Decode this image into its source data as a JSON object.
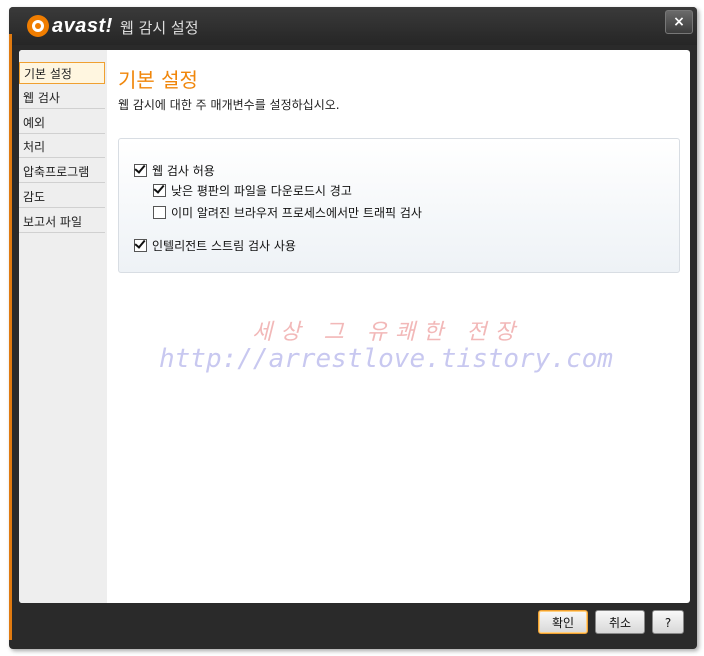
{
  "window": {
    "title": "웹 감시 설정",
    "logo_text": "avast!",
    "close_label": "×"
  },
  "sidebar": {
    "items": [
      {
        "label": "기본 설정",
        "active": true
      },
      {
        "label": "웹 검사",
        "active": false
      },
      {
        "label": "예외",
        "active": false
      },
      {
        "label": "처리",
        "active": false
      },
      {
        "label": "압축프로그램",
        "active": false
      },
      {
        "label": "감도",
        "active": false
      },
      {
        "label": "보고서 파일",
        "active": false
      }
    ]
  },
  "main": {
    "title": "기본 설정",
    "description": "웹 감시에 대한 주 매개변수를 설정하십시오.",
    "options": [
      {
        "label": "웹 검사 허용",
        "checked": true
      },
      {
        "label": "낮은 평판의 파일을 다운로드시 경고",
        "checked": true
      },
      {
        "label": "이미 알려진 브라우저 프로세스에서만 트래픽 검사",
        "checked": false
      },
      {
        "label": "인텔리전트 스트림 검사 사용",
        "checked": true
      }
    ]
  },
  "watermark": {
    "line1": "세상 그 유쾌한 전장",
    "line2": "http://arrestlove.tistory.com"
  },
  "footer": {
    "ok_label": "확인",
    "cancel_label": "취소",
    "help_label": "?"
  },
  "colors": {
    "accent": "#f0860a",
    "frame": "#2a2a2a"
  }
}
